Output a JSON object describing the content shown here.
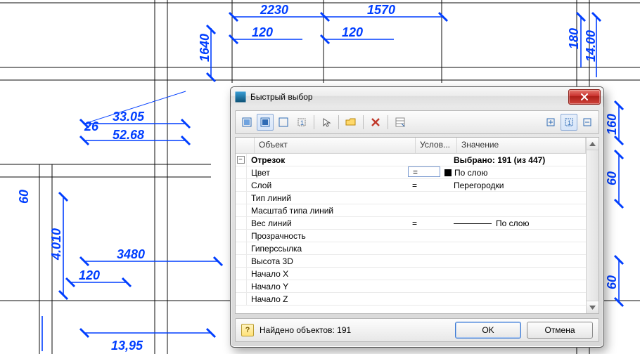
{
  "bg": {
    "dims": {
      "d1": "2230",
      "d2": "1570",
      "d3": "120",
      "d4": "120",
      "d5": "1640",
      "d6": "180",
      "d7": "14.00",
      "d8": "33.05",
      "d9": "52.68",
      "d10": "26",
      "d11": "160",
      "d12": "60",
      "d13": "60",
      "d14": "4.010",
      "d15": "3480",
      "d16": "120",
      "d17": "13,95",
      "d18": "60"
    }
  },
  "dialog": {
    "title": "Быстрый выбор",
    "toolbar_icons": [
      "select-all",
      "select-current",
      "select-none",
      "filter-1",
      "pick",
      "folder-open",
      "delete",
      "properties",
      "expand",
      "filter-2",
      "collapse"
    ],
    "columns": {
      "object": "Объект",
      "condition": "Услов...",
      "value": "Значение"
    },
    "rows": [
      {
        "kind": "group",
        "object": "Отрезок",
        "cond": "",
        "value": "Выбрано: 191 (из 447)"
      },
      {
        "kind": "sel",
        "object": "Цвет",
        "cond": "=",
        "value": "По слою",
        "swatch": true
      },
      {
        "kind": "row",
        "object": "Слой",
        "cond": "=",
        "value": "Перегородки"
      },
      {
        "kind": "row",
        "object": "Тип линий",
        "cond": "",
        "value": ""
      },
      {
        "kind": "row",
        "object": "Масштаб типа линий",
        "cond": "",
        "value": ""
      },
      {
        "kind": "row",
        "object": "Вес линий",
        "cond": "=",
        "value": "По слою",
        "linewt": true
      },
      {
        "kind": "row",
        "object": "Прозрачность",
        "cond": "",
        "value": ""
      },
      {
        "kind": "row",
        "object": "Гиперссылка",
        "cond": "",
        "value": ""
      },
      {
        "kind": "row",
        "object": "Высота 3D",
        "cond": "",
        "value": ""
      },
      {
        "kind": "row",
        "object": "Начало X",
        "cond": "",
        "value": ""
      },
      {
        "kind": "row",
        "object": "Начало Y",
        "cond": "",
        "value": ""
      },
      {
        "kind": "row",
        "object": "Начало Z",
        "cond": "",
        "value": ""
      }
    ],
    "status": "Найдено объектов: 191",
    "ok": "OK",
    "cancel": "Отмена"
  }
}
